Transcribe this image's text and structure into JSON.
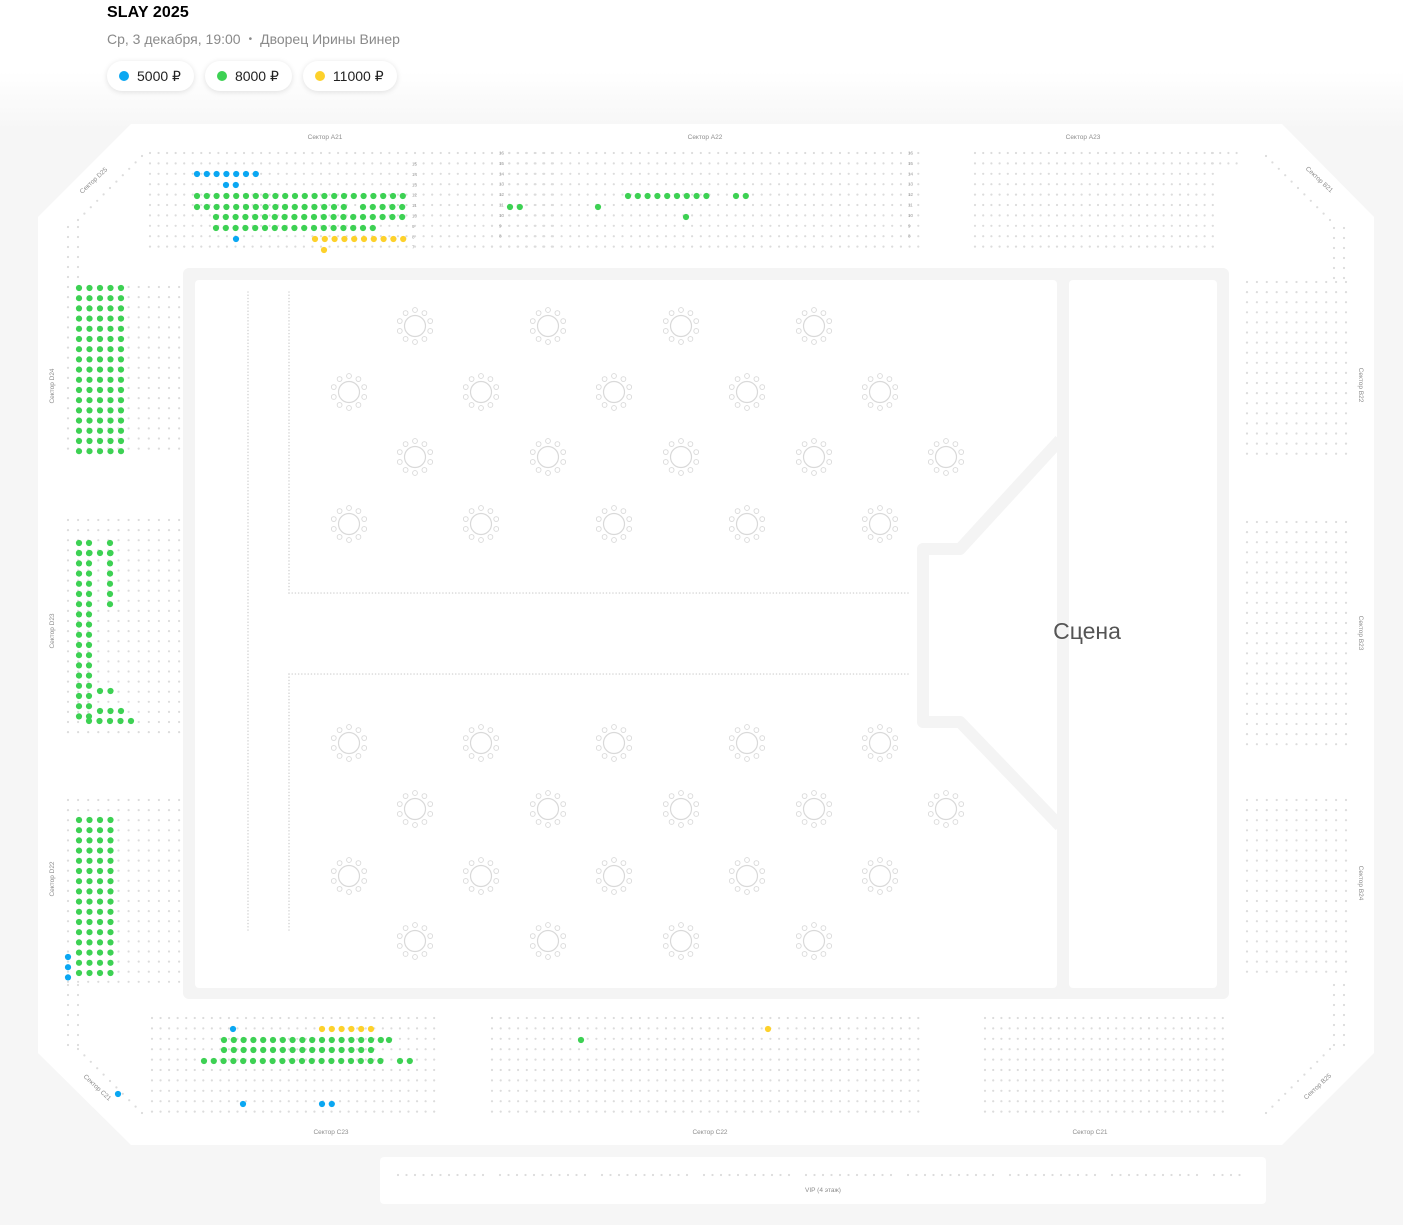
{
  "event": {
    "title": "SLAY 2025",
    "date": "Ср, 3 декабря, 19:00",
    "separator": "•",
    "venue": "Дворец Ирины Винер"
  },
  "legend": [
    {
      "label": "5000 ₽",
      "color": "#0aa7f2"
    },
    {
      "label": "8000 ₽",
      "color": "#3dd153"
    },
    {
      "label": "11000 ₽",
      "color": "#fdd12b"
    }
  ],
  "stage": {
    "label": "Сцена"
  },
  "vip": {
    "label": "VIP (4 этаж)"
  },
  "sectors": {
    "A21": "Сектор А21",
    "A22": "Сектор А22",
    "A23": "Сектор А23",
    "B21": "Сектор В21",
    "B22": "Сектор В22",
    "B23": "Сектор В23",
    "B24": "Сектор В24",
    "B25": "Сектор В25",
    "C21": "Сектор С21",
    "C22": "Сектор С22",
    "C23": "Сектор С23",
    "C21L": "Сектор С21",
    "D22": "Сектор D22",
    "D23": "Сектор D23",
    "D24": "Сектор D24",
    "D25": "Сектор D25"
  },
  "row_numbers": {
    "a21": [
      "15",
      "14",
      "13",
      "12",
      "11",
      "10",
      "9",
      "8",
      "7"
    ],
    "a22": [
      "16",
      "15",
      "14",
      "13",
      "12",
      "11",
      "10",
      "9",
      "8"
    ]
  }
}
